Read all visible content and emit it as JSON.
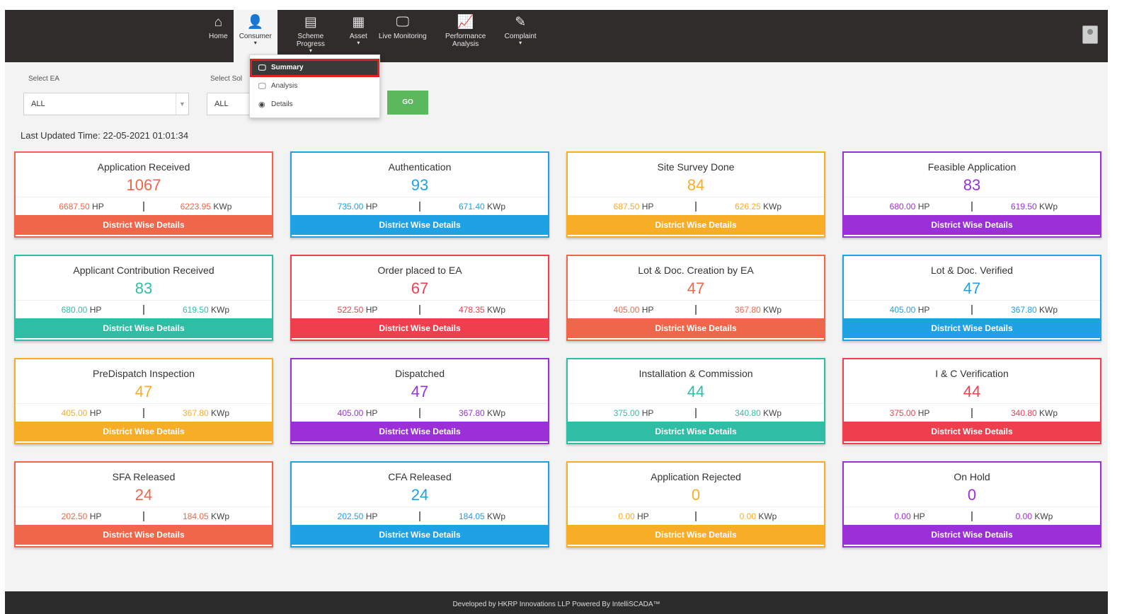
{
  "nav": [
    {
      "label": "Home",
      "icon": "home-icon",
      "glyph": "⌂",
      "caret": false,
      "active": false
    },
    {
      "label": "Consumer",
      "icon": "user-icon",
      "glyph": "👤",
      "caret": true,
      "active": true
    },
    {
      "label": "Scheme Progress",
      "icon": "list-icon",
      "glyph": "▤",
      "caret": true,
      "active": false
    },
    {
      "label": "Asset",
      "icon": "grid-icon",
      "glyph": "▦",
      "caret": true,
      "active": false
    },
    {
      "label": "Live Monitoring",
      "icon": "monitor-icon",
      "glyph": "🖵",
      "caret": false,
      "active": false
    },
    {
      "label": "Performance Analysis",
      "icon": "chart-icon",
      "glyph": "📈",
      "caret": false,
      "active": false
    },
    {
      "label": "Complaint",
      "icon": "edit-icon",
      "glyph": "✎",
      "caret": true,
      "active": false
    }
  ],
  "dropdown": [
    {
      "label": "Summary",
      "icon": "monitor-icon",
      "glyph": "🖵",
      "selected": true
    },
    {
      "label": "Analysis",
      "icon": "monitor-icon",
      "glyph": "🖵",
      "selected": false
    },
    {
      "label": "Details",
      "icon": "globe-icon",
      "glyph": "◉",
      "selected": false
    }
  ],
  "filters": {
    "ea_label": "Select EA",
    "ea_value": "ALL",
    "second_label": "Select Sol",
    "second_value": "ALL",
    "go_label": "GO"
  },
  "last_updated_label": "Last Updated Time:",
  "last_updated_value": "22-05-2021 01:01:34",
  "hp_unit": "HP",
  "kwp_unit": "KWp",
  "cards": [
    {
      "title": "Application Received",
      "count": "1067",
      "hp": "6687.50",
      "kwp": "6223.95",
      "color": "#f0664a",
      "button": "District Wise Details"
    },
    {
      "title": "Authentication",
      "count": "93",
      "hp": "735.00",
      "kwp": "671.40",
      "color": "#1ea2e3",
      "button": "District Wise Details"
    },
    {
      "title": "Site Survey Done",
      "count": "84",
      "hp": "687.50",
      "kwp": "626.25",
      "color": "#f8ad26",
      "button": "District Wise Details"
    },
    {
      "title": "Feasible Application",
      "count": "83",
      "hp": "680.00",
      "kwp": "619.50",
      "color": "#9b30d8",
      "button": "District Wise Details"
    },
    {
      "title": "Applicant Contribution Received",
      "count": "83",
      "hp": "680.00",
      "kwp": "619.50",
      "color": "#2fbda6",
      "button": "District Wise Details"
    },
    {
      "title": "Order placed to EA",
      "count": "67",
      "hp": "522.50",
      "kwp": "478.35",
      "color": "#ef3f4e",
      "button": "District Wise Details"
    },
    {
      "title": "Lot & Doc. Creation by EA",
      "count": "47",
      "hp": "405.00",
      "kwp": "367.80",
      "color": "#f0664a",
      "button": "District Wise Details"
    },
    {
      "title": "Lot & Doc. Verified",
      "count": "47",
      "hp": "405.00",
      "kwp": "367.80",
      "color": "#1ea2e3",
      "button": "District Wise Details"
    },
    {
      "title": "PreDispatch Inspection",
      "count": "47",
      "hp": "405.00",
      "kwp": "367.80",
      "color": "#f8ad26",
      "button": "District Wise Details"
    },
    {
      "title": "Dispatched",
      "count": "47",
      "hp": "405.00",
      "kwp": "367.80",
      "color": "#9b30d8",
      "button": "District Wise Details"
    },
    {
      "title": "Installation & Commission",
      "count": "44",
      "hp": "375.00",
      "kwp": "340.80",
      "color": "#2fbda6",
      "button": "District Wise Details"
    },
    {
      "title": "I & C Verification",
      "count": "44",
      "hp": "375.00",
      "kwp": "340.80",
      "color": "#ef3f4e",
      "button": "District Wise Details"
    },
    {
      "title": "SFA Released",
      "count": "24",
      "hp": "202.50",
      "kwp": "184.05",
      "color": "#f0664a",
      "button": "District Wise Details"
    },
    {
      "title": "CFA Released",
      "count": "24",
      "hp": "202.50",
      "kwp": "184.05",
      "color": "#1ea2e3",
      "button": "District Wise Details"
    },
    {
      "title": "Application Rejected",
      "count": "0",
      "hp": "0.00",
      "kwp": "0.00",
      "color": "#f8ad26",
      "button": "District Wise Details"
    },
    {
      "title": "On Hold",
      "count": "0",
      "hp": "0.00",
      "kwp": "0.00",
      "color": "#9b30d8",
      "button": "District Wise Details"
    }
  ],
  "footer": "Developed by HKRP Innovations LLP Powered By IntelliSCADA™"
}
